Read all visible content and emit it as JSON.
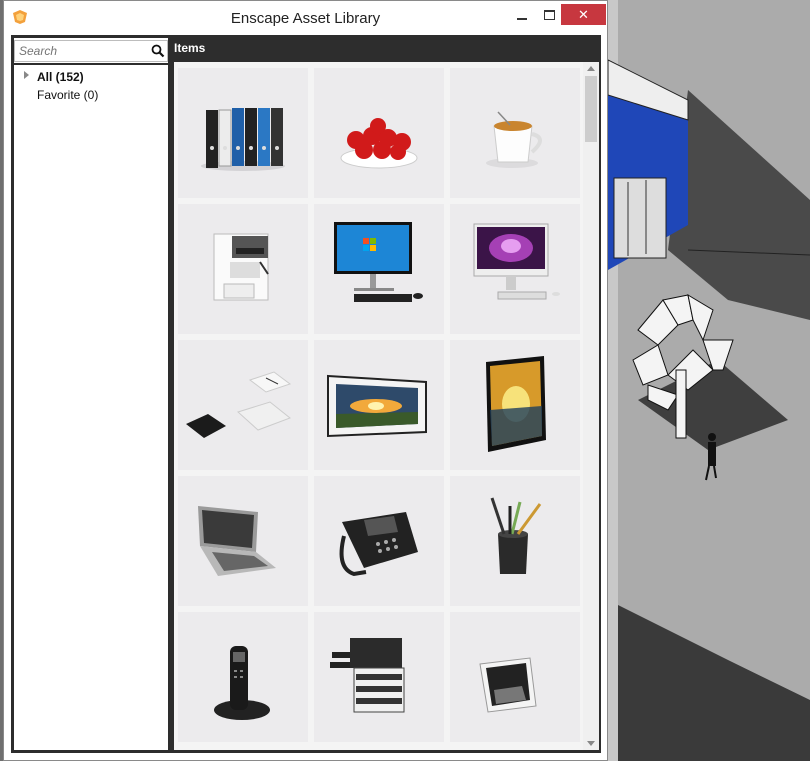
{
  "window": {
    "title": "Enscape Asset Library",
    "controls": {
      "minimize": "minimize",
      "maximize": "maximize",
      "close": "✕"
    }
  },
  "search": {
    "placeholder": "Search",
    "value": ""
  },
  "tree": [
    {
      "label": "All (152)",
      "expanded": false
    },
    {
      "label": "Favorite (0)"
    }
  ],
  "items_header": "Items",
  "assets": [
    {
      "icon": "binders-icon"
    },
    {
      "icon": "apple-bowl-icon"
    },
    {
      "icon": "coffee-cup-icon"
    },
    {
      "icon": "coffee-machine-icon"
    },
    {
      "icon": "windows-monitor-icon"
    },
    {
      "icon": "mac-monitor-icon"
    },
    {
      "icon": "desk-papers-icon"
    },
    {
      "icon": "landscape-painting-icon"
    },
    {
      "icon": "framed-picture-icon"
    },
    {
      "icon": "laptop-icon"
    },
    {
      "icon": "desk-phone-icon"
    },
    {
      "icon": "pencil-cup-icon"
    },
    {
      "icon": "cordless-phone-icon"
    },
    {
      "icon": "printer-icon"
    },
    {
      "icon": "photo-frame-icon"
    }
  ],
  "colors": {
    "close_button": "#c7373f",
    "frame": "#2d2d2d",
    "tile_bg": "#ecebed",
    "building_blue": "#1f47b8"
  }
}
